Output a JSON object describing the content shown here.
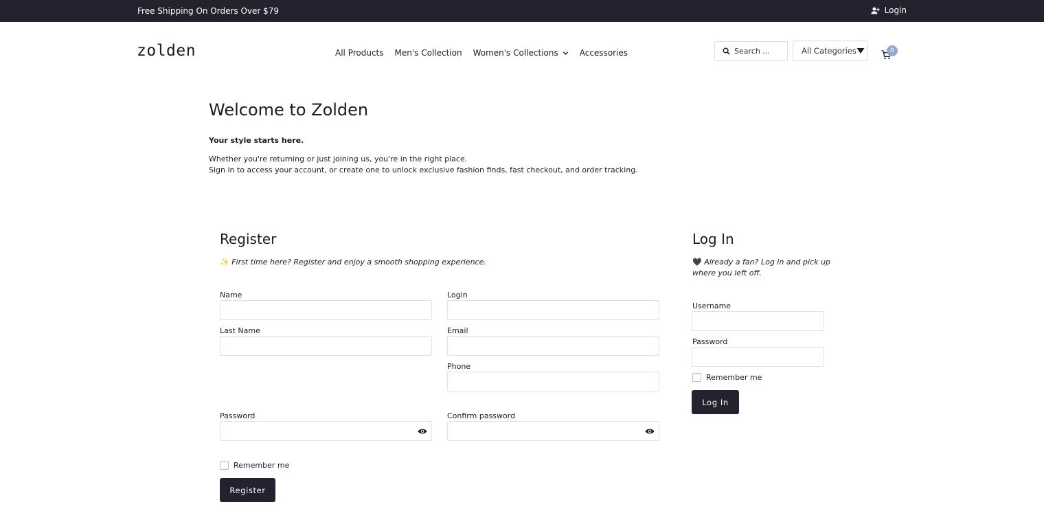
{
  "topbar": {
    "promo": "Free Shipping On Orders Over $79",
    "login_label": "Login"
  },
  "header": {
    "logo": "zolden",
    "nav": [
      "All Products",
      "Men's Collection",
      "Women's Collections",
      "Accessories"
    ],
    "search_placeholder": "Search ...",
    "category_selected": "All Categories",
    "cart_count": "0"
  },
  "intro": {
    "title": "Welcome to Zolden",
    "tagline": "Your style starts here.",
    "line1": "Whether you're returning or just joining us, you're in the right place.",
    "line2": "Sign in to access your account, or create one to unlock exclusive fashion finds, fast checkout, and order tracking."
  },
  "register": {
    "title": "Register",
    "subtitle_emoji": "✨",
    "subtitle": "First time here? Register and enjoy a smooth shopping experience.",
    "name_label": "Name",
    "login_label": "Login",
    "lastname_label": "Last Name",
    "email_label": "Email",
    "phone_label": "Phone",
    "password_label": "Password",
    "confirm_label": "Confirm password",
    "remember_label": "Remember me",
    "button": "Register"
  },
  "login": {
    "title": "Log In",
    "subtitle_emoji": "🖤",
    "subtitle_line1": "Already a fan? Log in and pick up",
    "subtitle_line2": "where you left off.",
    "username_label": "Username",
    "password_label": "Password",
    "remember_label": "Remember me",
    "button": "Log In"
  },
  "colors": {
    "dark": "#23232f",
    "cart_badge": "#93a9cc"
  }
}
